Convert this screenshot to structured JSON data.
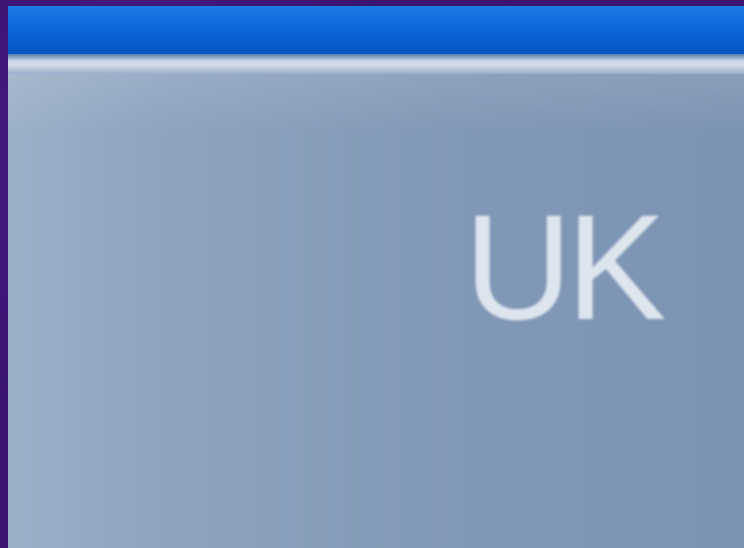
{
  "window": {
    "content_label": "UK"
  },
  "colors": {
    "desktop_background": "#3a1470",
    "titlebar": "#0a64d8",
    "content_panel": "#8198b6",
    "label_text": "#e6ecf4"
  }
}
